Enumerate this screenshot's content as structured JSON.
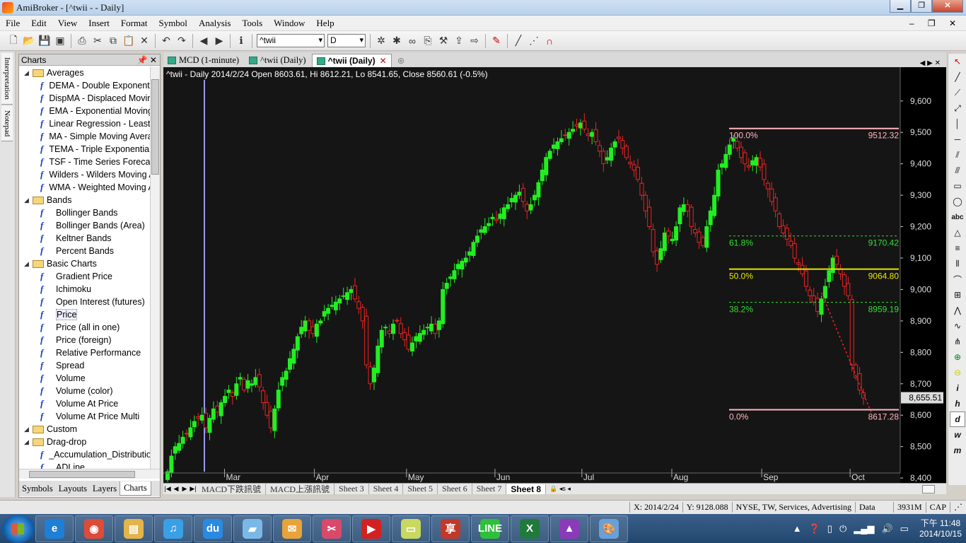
{
  "window": {
    "title": "AmiBroker - [^twii - - Daily]",
    "controls": [
      "▁",
      "❐",
      "✕"
    ]
  },
  "menu": [
    "File",
    "Edit",
    "View",
    "Insert",
    "Format",
    "Symbol",
    "Analysis",
    "Tools",
    "Window",
    "Help"
  ],
  "toolbar": {
    "symbol": "^twii",
    "interval": "D"
  },
  "left_strip": [
    "Interpretation",
    "Notepad"
  ],
  "charts_panel": {
    "title": "Charts",
    "tree": [
      {
        "type": "folder",
        "label": "Averages"
      },
      {
        "type": "item",
        "label": "DEMA - Double Exponential Moving Average"
      },
      {
        "type": "item",
        "label": "DispMA - Displaced Moving Average"
      },
      {
        "type": "item",
        "label": "EMA - Exponential Moving Average"
      },
      {
        "type": "item",
        "label": "Linear Regression - Least Squares"
      },
      {
        "type": "item",
        "label": "MA - Simple Moving Average"
      },
      {
        "type": "item",
        "label": "TEMA - Triple Exponential Moving Average"
      },
      {
        "type": "item",
        "label": "TSF - Time Series Forecast"
      },
      {
        "type": "item",
        "label": "Wilders - Wilders Moving Average"
      },
      {
        "type": "item",
        "label": "WMA - Weighted Moving Average"
      },
      {
        "type": "folder",
        "label": "Bands"
      },
      {
        "type": "item",
        "label": "Bollinger Bands"
      },
      {
        "type": "item",
        "label": "Bollinger Bands (Area)"
      },
      {
        "type": "item",
        "label": "Keltner Bands"
      },
      {
        "type": "item",
        "label": "Percent Bands"
      },
      {
        "type": "folder",
        "label": "Basic Charts"
      },
      {
        "type": "item",
        "label": "Gradient Price"
      },
      {
        "type": "item",
        "label": "Ichimoku"
      },
      {
        "type": "item",
        "label": "Open Interest (futures)"
      },
      {
        "type": "item",
        "label": "Price",
        "selected": true
      },
      {
        "type": "item",
        "label": "Price (all in one)"
      },
      {
        "type": "item",
        "label": "Price (foreign)"
      },
      {
        "type": "item",
        "label": "Relative Performance"
      },
      {
        "type": "item",
        "label": "Spread"
      },
      {
        "type": "item",
        "label": "Volume"
      },
      {
        "type": "item",
        "label": "Volume (color)"
      },
      {
        "type": "item",
        "label": "Volume At Price"
      },
      {
        "type": "item",
        "label": "Volume At Price Multi"
      },
      {
        "type": "folder",
        "label": "Custom"
      },
      {
        "type": "folder",
        "label": "Drag-drop"
      },
      {
        "type": "item",
        "label": "_Accumulation_Distribution"
      },
      {
        "type": "item",
        "label": "ADLine"
      }
    ],
    "bottom_tabs": [
      "Symbols",
      "Layouts",
      "Layers",
      "Charts"
    ],
    "active_bottom_tab": "Charts"
  },
  "doc_tabs": [
    {
      "label": "MCD (1-minute)",
      "active": false
    },
    {
      "label": "^twii (Daily)",
      "active": false
    },
    {
      "label": "^twii (Daily)",
      "active": true
    }
  ],
  "chart_header": "^twii - Daily 2014/2/24 Open 8603.61, Hi 8612.21, Lo 8541.65, Close 8560.61 (-0.5%)",
  "chart_data": {
    "type": "candlestick",
    "title": "^twii - Daily 2014/2/24 Open 8603.61, Hi 8612.21, Lo 8541.65, Close 8560.61 (-0.5%)",
    "ylim": [
      8380,
      9640
    ],
    "y_ticks": [
      "9,600",
      "9,500",
      "9,400",
      "9,300",
      "9,200",
      "9,100",
      "9,000",
      "8,900",
      "8,800",
      "8,700",
      "8,600",
      "8,500",
      "8,400"
    ],
    "x_ticks": [
      "Mar",
      "Apr",
      "May",
      "Jun",
      "Jul",
      "Aug",
      "Sep",
      "Oct"
    ],
    "current_price_label": "8,655.51",
    "current_price": 8655.51,
    "up_color": "#22ee22",
    "down_color": "#ee2222",
    "grid": false,
    "fibonacci": [
      {
        "level": "100.0%",
        "value": 9512.32,
        "label": "9512.32",
        "color": "#ffb6c1"
      },
      {
        "level": "61.8%",
        "value": 9170.42,
        "label": "9170.42",
        "color": "#33dd33"
      },
      {
        "level": "50.0%",
        "value": 9064.8,
        "label": "9064.80",
        "color": "#e8e800"
      },
      {
        "level": "38.2%",
        "value": 8959.19,
        "label": "8959.19",
        "color": "#33dd33"
      },
      {
        "level": "0.0%",
        "value": 8617.28,
        "label": "8617.28",
        "color": "#ffb6c1"
      }
    ],
    "trendline": {
      "from": {
        "date": "2014/9/29",
        "value": 8990
      },
      "to": {
        "date": "2014/10/15",
        "value": 8610
      },
      "color": "#ee2222"
    },
    "closes_approx": [
      8420,
      8470,
      8500,
      8510,
      8530,
      8540,
      8560,
      8580,
      8590,
      8600,
      8560,
      8590,
      8620,
      8610,
      8640,
      8660,
      8680,
      8660,
      8700,
      8720,
      8680,
      8710,
      8700,
      8720,
      8690,
      8640,
      8600,
      8560,
      8620,
      8680,
      8720,
      8740,
      8780,
      8810,
      8850,
      8880,
      8900,
      8870,
      8860,
      8890,
      8900,
      8930,
      8940,
      8950,
      8960,
      8970,
      8980,
      8990,
      9000,
      8970,
      8940,
      8900,
      8760,
      8700,
      8750,
      8820,
      8870,
      8880,
      8860,
      8890,
      8900,
      8860,
      8840,
      8810,
      8830,
      8850,
      8860,
      8870,
      8880,
      8890,
      8860,
      8900,
      9000,
      9020,
      9040,
      9060,
      9080,
      9090,
      9100,
      9120,
      9150,
      9170,
      9190,
      9200,
      9210,
      9230,
      9220,
      9240,
      9260,
      9270,
      9290,
      9300,
      9310,
      9280,
      9250,
      9270,
      9300,
      9340,
      9380,
      9420,
      9440,
      9460,
      9470,
      9480,
      9490,
      9500,
      9510,
      9520,
      9530,
      9510,
      9490,
      9500,
      9470,
      9440,
      9400,
      9420,
      9450,
      9470,
      9480,
      9450,
      9420,
      9400,
      9380,
      9350,
      9300,
      9250,
      9200,
      9120,
      9080,
      9130,
      9180,
      9170,
      9160,
      9200,
      9260,
      9270,
      9250,
      9200,
      9180,
      9150,
      9140,
      9200,
      9250,
      9300,
      9380,
      9400,
      9430,
      9460,
      9480,
      9450,
      9420,
      9400,
      9390,
      9410,
      9420,
      9390,
      9350,
      9320,
      9280,
      9250,
      9200,
      9180,
      9160,
      9140,
      9100,
      9080,
      9050,
      9010,
      8980,
      8960,
      8930,
      8970,
      9010,
      9060,
      9100,
      9080,
      9050,
      9010,
      8980,
      8760,
      8720,
      8680,
      8655
    ]
  },
  "sheet_tabs": [
    "MACD下跌訊號",
    "MACD上漲訊號",
    "Sheet 3",
    "Sheet 4",
    "Sheet 5",
    "Sheet 6",
    "Sheet 7",
    "Sheet 8"
  ],
  "active_sheet": "Sheet 8",
  "status": {
    "x": "X: 2014/2/24",
    "y": "Y: 9128.088",
    "info": "NYSE, TW, Services, Advertising",
    "data": "Data",
    "mem": "3931M",
    "cap": "CAP"
  },
  "taskbar": {
    "apps": [
      {
        "name": "Internet Explorer",
        "glyph": "e",
        "color": "#1e7fd6"
      },
      {
        "name": "Chrome",
        "glyph": "◉",
        "color": "#dd4b39"
      },
      {
        "name": "File Explorer",
        "glyph": "▤",
        "color": "#e3b44a"
      },
      {
        "name": "iTunes",
        "glyph": "♫",
        "color": "#3aa0e6"
      },
      {
        "name": "Baidu Cloud",
        "glyph": "du",
        "color": "#2a8ae2"
      },
      {
        "name": "Notes",
        "glyph": "▰",
        "color": "#7ab8e8"
      },
      {
        "name": "Mail",
        "glyph": "✉",
        "color": "#e8a33a"
      },
      {
        "name": "Snipping Tool",
        "glyph": "✂",
        "color": "#d94a6a"
      },
      {
        "name": "Media Player",
        "glyph": "▶",
        "color": "#d32020"
      },
      {
        "name": "Notes2",
        "glyph": "▭",
        "color": "#c8d860"
      },
      {
        "name": "Dictionary",
        "glyph": "享",
        "color": "#c0392b"
      },
      {
        "name": "LINE",
        "glyph": "LINE",
        "color": "#2fbf3a"
      },
      {
        "name": "Excel",
        "glyph": "X",
        "color": "#1f7a3c"
      },
      {
        "name": "AmiBroker",
        "glyph": "▲",
        "color": "#8a3bb8"
      },
      {
        "name": "Paint",
        "glyph": "🎨",
        "color": "#6aa0d8"
      }
    ],
    "time": "下午 11:48",
    "date": "2014/10/15"
  }
}
